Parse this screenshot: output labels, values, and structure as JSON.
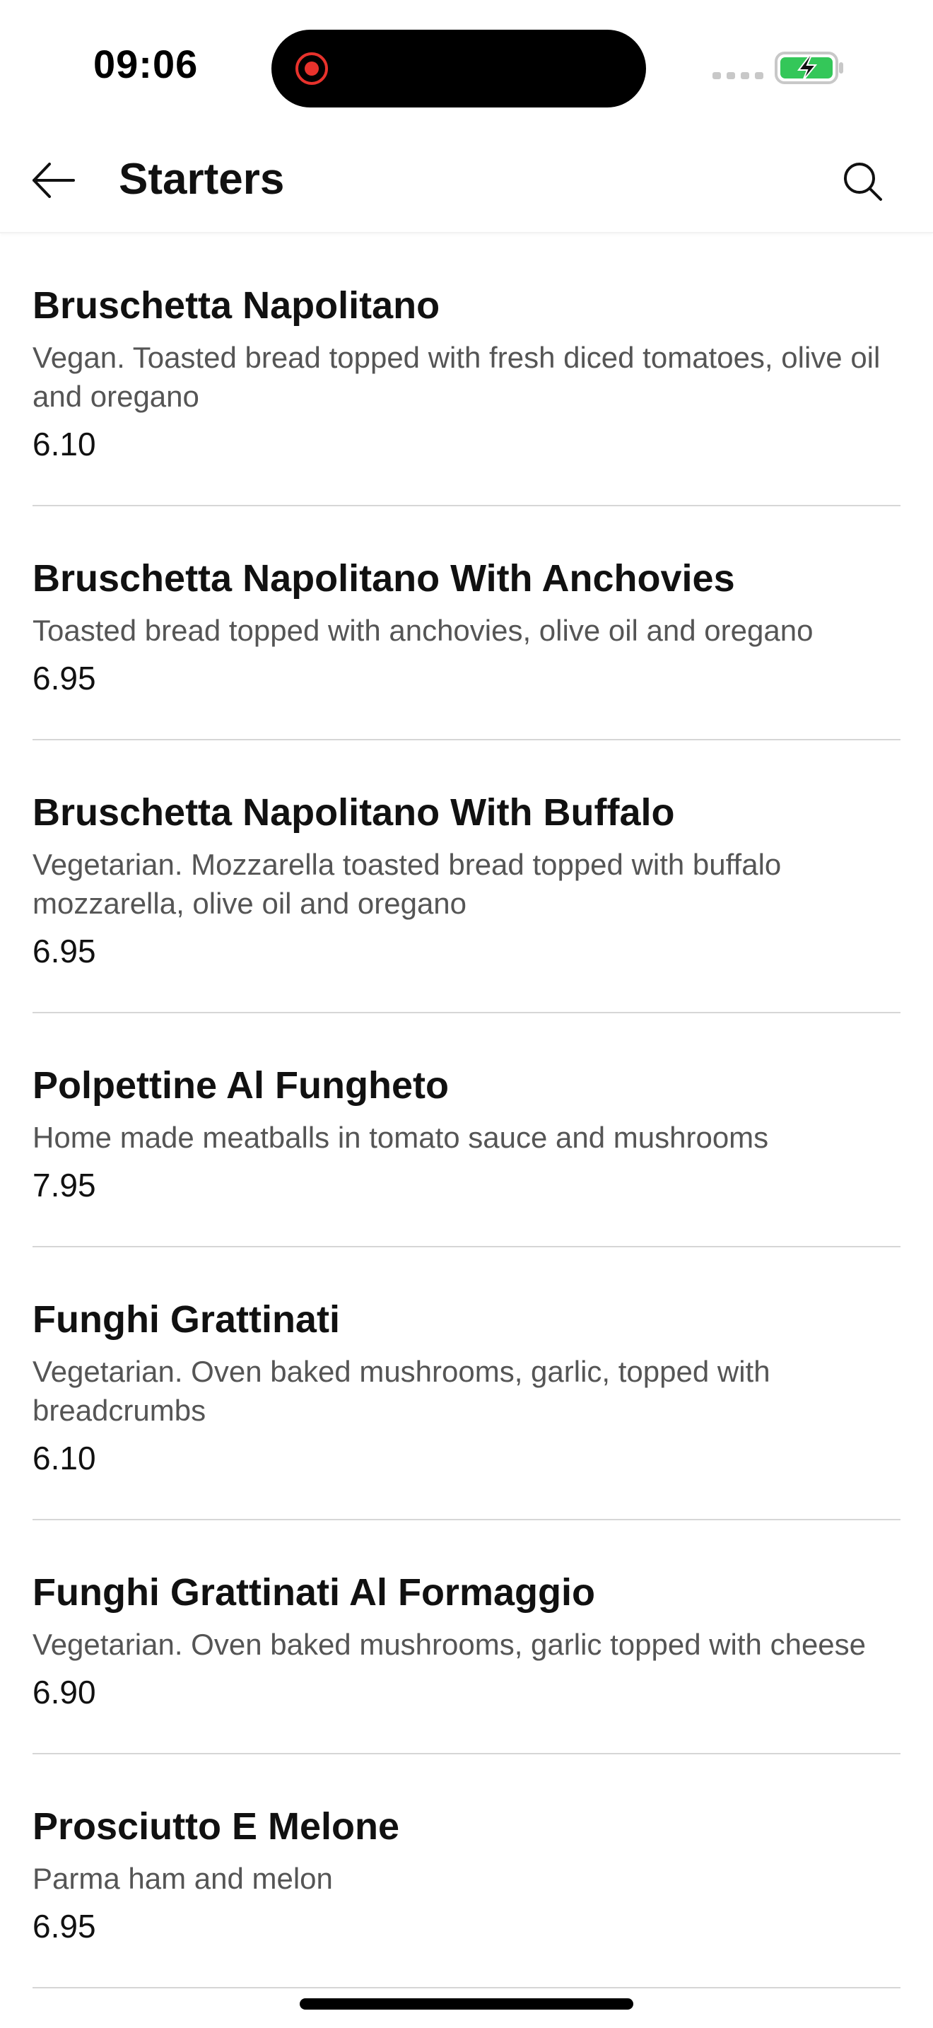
{
  "status_bar": {
    "time": "09:06"
  },
  "header": {
    "title": "Starters",
    "back_icon": "arrow-left-icon",
    "search_icon": "search-icon"
  },
  "colors": {
    "record_dot": "#e8322c",
    "battery_green": "#34c759",
    "divider": "#d6d6d6",
    "description_text": "#555555"
  },
  "items": [
    {
      "name": "Bruschetta Napolitano",
      "description": "Vegan. Toasted bread topped with fresh diced tomatoes, olive oil and oregano",
      "price": "6.10"
    },
    {
      "name": "Bruschetta Napolitano With Anchovies",
      "description": "Toasted bread topped with anchovies, olive oil and oregano",
      "price": "6.95"
    },
    {
      "name": "Bruschetta Napolitano With Buffalo",
      "description": "Vegetarian. Mozzarella toasted bread topped with buffalo mozzarella, olive oil and oregano",
      "price": "6.95"
    },
    {
      "name": "Polpettine Al Fungheto",
      "description": "Home made meatballs in tomato sauce and mushrooms",
      "price": "7.95"
    },
    {
      "name": "Funghi Grattinati",
      "description": "Vegetarian. Oven baked mushrooms, garlic, topped with breadcrumbs",
      "price": "6.10"
    },
    {
      "name": "Funghi Grattinati Al Formaggio",
      "description": "Vegetarian. Oven baked mushrooms, garlic topped with cheese",
      "price": "6.90"
    },
    {
      "name": "Prosciutto E Melone",
      "description": "Parma ham and melon",
      "price": "6.95"
    }
  ]
}
